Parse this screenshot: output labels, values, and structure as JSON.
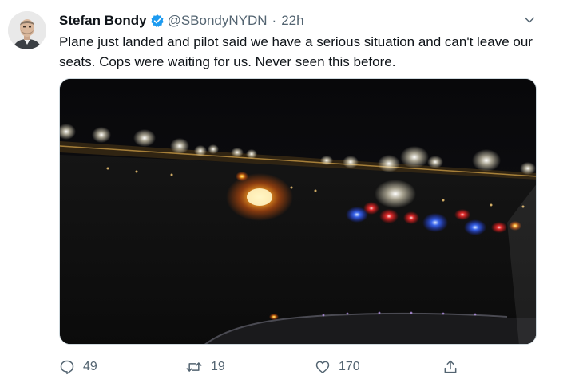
{
  "tweet": {
    "display_name": "Stefan Bondy",
    "handle": "@SBondyNYDN",
    "separator": "·",
    "time": "22h",
    "text": "Plane just landed and pilot said we have a serious situation and can't leave our seats. Cops were waiting for us. Never seen this before.",
    "verified": true,
    "media": {
      "kind": "night photo of airport tarmac with police lights"
    }
  },
  "actions": {
    "reply_count": "49",
    "retweet_count": "19",
    "like_count": "170"
  },
  "icons": {
    "reply": "reply-icon",
    "retweet": "retweet-icon",
    "like": "heart-icon",
    "share": "share-icon",
    "caret": "chevron-down-icon",
    "verified": "verified-badge-icon"
  },
  "colors": {
    "verified_blue": "#1d9bf0",
    "text_primary": "#0f1419",
    "text_secondary": "#536471"
  }
}
